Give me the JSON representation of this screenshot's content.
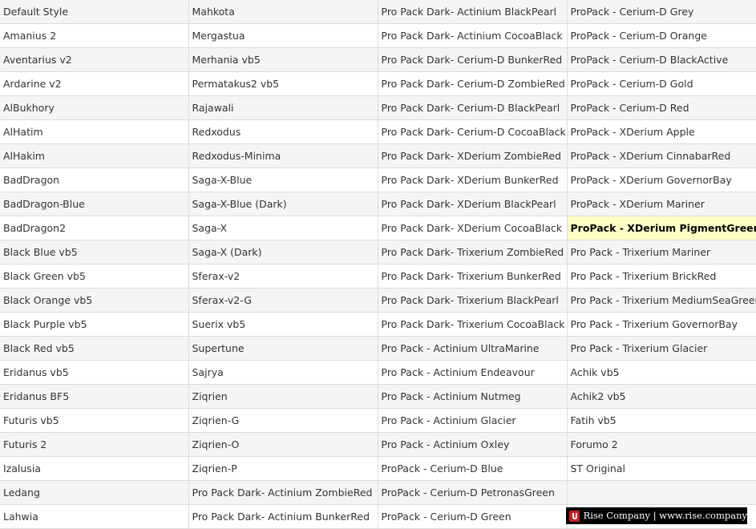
{
  "grid": {
    "selected_item": "ProPack - XDerium PigmentGreen",
    "columns": [
      [
        "Default Style",
        "Amanius 2",
        "Aventarius v2",
        "Ardarine v2",
        "AlBukhory",
        "AlHatim",
        "AlHakim",
        "BadDragon",
        "BadDragon-Blue",
        "BadDragon2",
        "Black Blue vb5",
        "Black Green vb5",
        "Black Orange vb5",
        "Black Purple vb5",
        "Black Red vb5",
        "Eridanus vb5",
        "Eridanus BF5",
        "Futuris vb5",
        "Futuris 2",
        "Izalusia",
        "Ledang",
        "Lahwia"
      ],
      [
        "Mahkota",
        "Mergastua",
        "Merhania vb5",
        "Permatakus2 vb5",
        "Rajawali",
        "Redxodus",
        "Redxodus-Minima",
        "Saga-X-Blue",
        "Saga-X-Blue (Dark)",
        "Saga-X",
        "Saga-X (Dark)",
        "Sferax-v2",
        "Sferax-v2-G",
        "Suerix vb5",
        "Supertune",
        "Sajrya",
        "Ziqrien",
        "Ziqrien-G",
        "Ziqrien-O",
        "Ziqrien-P",
        "Pro Pack Dark- Actinium ZombieRed",
        "Pro Pack Dark- Actinium BunkerRed"
      ],
      [
        "Pro Pack Dark- Actinium BlackPearl",
        "Pro Pack Dark- Actinium CocoaBlack",
        "Pro Pack Dark- Cerium-D BunkerRed",
        "Pro Pack Dark- Cerium-D ZombieRed",
        "Pro Pack Dark- Cerium-D BlackPearl",
        "Pro Pack Dark- Cerium-D CocoaBlack",
        "Pro Pack Dark- XDerium ZombieRed",
        "Pro Pack Dark- XDerium BunkerRed",
        "Pro Pack Dark- XDerium BlackPearl",
        "Pro Pack Dark- XDerium CocoaBlack",
        "Pro Pack Dark- Trixerium ZombieRed",
        "Pro Pack Dark- Trixerium BunkerRed",
        "Pro Pack Dark- Trixerium BlackPearl",
        "Pro Pack Dark- Trixerium CocoaBlack",
        "Pro Pack - Actinium UltraMarine",
        "Pro Pack - Actinium Endeavour",
        "Pro Pack - Actinium Nutmeg",
        "Pro Pack - Actinium Glacier",
        "Pro Pack - Actinium Oxley",
        "ProPack - Cerium-D Blue",
        "ProPack - Cerium-D PetronasGreen",
        "ProPack - Cerium-D Green"
      ],
      [
        "ProPack - Cerium-D Grey",
        "ProPack - Cerium-D Orange",
        "ProPack - Cerium-D BlackActive",
        "ProPack - Cerium-D Gold",
        "ProPack - Cerium-D Red",
        "ProPack - XDerium Apple",
        "ProPack - XDerium CinnabarRed",
        "ProPack - XDerium GovernorBay",
        "ProPack - XDerium Mariner",
        "ProPack - XDerium PigmentGreen",
        "Pro Pack - Trixerium Mariner",
        "Pro Pack - Trixerium BrickRed",
        "Pro Pack - Trixerium MediumSeaGreen",
        "Pro Pack - Trixerium GovernorBay",
        "Pro Pack - Trixerium Glacier",
        "Achik vb5",
        "Achik2 vb5",
        "Fatih vb5",
        "Forumo 2",
        "ST Original",
        "",
        ""
      ]
    ]
  },
  "watermark": {
    "text": "Rise Company | www.rise.company",
    "logo_icon": "rise-logo-icon"
  },
  "colors": {
    "row_odd": "#f5f5f5",
    "row_even": "#ffffff",
    "selected_bg": "#ffffc6",
    "border": "#dcdcdc",
    "watermark_bg": "#000000",
    "logo_red": "#c81e1e"
  }
}
